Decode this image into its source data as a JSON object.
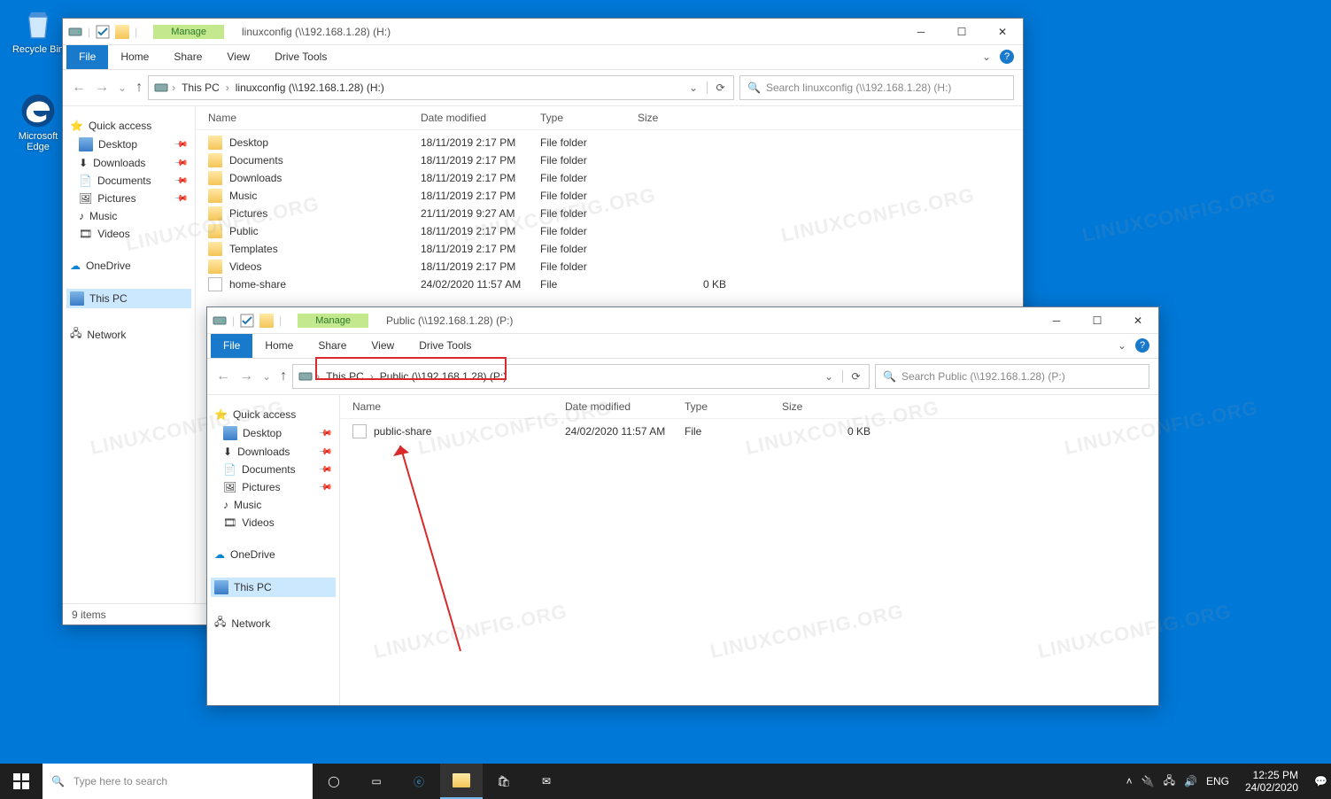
{
  "desktop": {
    "icons": [
      {
        "name": "recycle-bin",
        "label": "Recycle Bin"
      },
      {
        "name": "edge",
        "label": "Microsoft Edge"
      }
    ]
  },
  "watermark": "LINUXCONFIG.ORG",
  "window1": {
    "title": "linuxconfig (\\\\192.168.1.28) (H:)",
    "ctx_tab": "Manage",
    "tabs": {
      "file": "File",
      "home": "Home",
      "share": "Share",
      "view": "View",
      "ctx": "Drive Tools"
    },
    "breadcrumb": [
      "This PC",
      "linuxconfig (\\\\192.168.1.28) (H:)"
    ],
    "search_placeholder": "Search linuxconfig (\\\\192.168.1.28) (H:)",
    "columns": {
      "name": "Name",
      "date": "Date modified",
      "type": "Type",
      "size": "Size"
    },
    "nav": {
      "quick_label": "Quick access",
      "quick": [
        "Desktop",
        "Downloads",
        "Documents",
        "Pictures",
        "Music",
        "Videos"
      ],
      "onedrive": "OneDrive",
      "thispc": "This PC",
      "network": "Network"
    },
    "rows": [
      {
        "name": "Desktop",
        "date": "18/11/2019 2:17 PM",
        "type": "File folder",
        "size": ""
      },
      {
        "name": "Documents",
        "date": "18/11/2019 2:17 PM",
        "type": "File folder",
        "size": ""
      },
      {
        "name": "Downloads",
        "date": "18/11/2019 2:17 PM",
        "type": "File folder",
        "size": ""
      },
      {
        "name": "Music",
        "date": "18/11/2019 2:17 PM",
        "type": "File folder",
        "size": ""
      },
      {
        "name": "Pictures",
        "date": "21/11/2019 9:27 AM",
        "type": "File folder",
        "size": ""
      },
      {
        "name": "Public",
        "date": "18/11/2019 2:17 PM",
        "type": "File folder",
        "size": ""
      },
      {
        "name": "Templates",
        "date": "18/11/2019 2:17 PM",
        "type": "File folder",
        "size": ""
      },
      {
        "name": "Videos",
        "date": "18/11/2019 2:17 PM",
        "type": "File folder",
        "size": ""
      },
      {
        "name": "home-share",
        "date": "24/02/2020 11:57 AM",
        "type": "File",
        "size": "0 KB"
      }
    ],
    "status": "9 items"
  },
  "window2": {
    "title": "Public (\\\\192.168.1.28) (P:)",
    "ctx_tab": "Manage",
    "tabs": {
      "file": "File",
      "home": "Home",
      "share": "Share",
      "view": "View",
      "ctx": "Drive Tools"
    },
    "breadcrumb": [
      "This PC",
      "Public (\\\\192.168.1.28) (P:)"
    ],
    "search_placeholder": "Search Public (\\\\192.168.1.28) (P:)",
    "columns": {
      "name": "Name",
      "date": "Date modified",
      "type": "Type",
      "size": "Size"
    },
    "nav": {
      "quick_label": "Quick access",
      "quick": [
        "Desktop",
        "Downloads",
        "Documents",
        "Pictures",
        "Music",
        "Videos"
      ],
      "onedrive": "OneDrive",
      "thispc": "This PC",
      "network": "Network"
    },
    "rows": [
      {
        "name": "public-share",
        "date": "24/02/2020 11:57 AM",
        "type": "File",
        "size": "0 KB"
      }
    ]
  },
  "taskbar": {
    "search_placeholder": "Type here to search",
    "lang": "ENG",
    "time": "12:25 PM",
    "date": "24/02/2020"
  }
}
